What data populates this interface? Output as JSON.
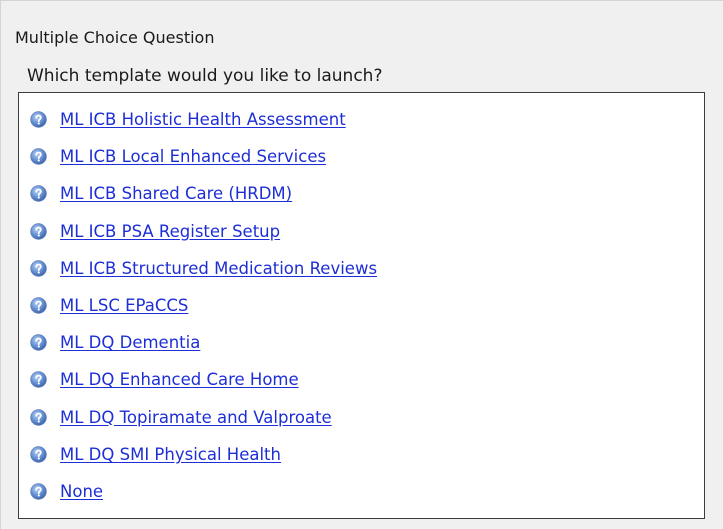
{
  "window": {
    "title": "Multiple Choice Question"
  },
  "question": {
    "text": "Which template would you like to launch?"
  },
  "options": [
    {
      "label": "ML ICB Holistic Health Assessment",
      "icon": "help-icon"
    },
    {
      "label": "ML ICB Local Enhanced Services",
      "icon": "help-icon"
    },
    {
      "label": "ML ICB Shared Care (HRDM)",
      "icon": "help-icon"
    },
    {
      "label": "ML ICB PSA Register Setup",
      "icon": "help-icon"
    },
    {
      "label": "ML ICB Structured Medication Reviews",
      "icon": "help-icon"
    },
    {
      "label": "ML LSC EPaCCS",
      "icon": "help-icon"
    },
    {
      "label": "ML DQ Dementia",
      "icon": "help-icon"
    },
    {
      "label": "ML DQ Enhanced Care Home",
      "icon": "help-icon"
    },
    {
      "label": "ML DQ Topiramate and Valproate",
      "icon": "help-icon"
    },
    {
      "label": "ML DQ SMI Physical Health",
      "icon": "help-icon"
    },
    {
      "label": "None",
      "icon": "help-icon"
    }
  ],
  "colors": {
    "link": "#1d2ed6",
    "icon_blue": "#3f72c6",
    "panel_bg": "#f0f0f0"
  }
}
